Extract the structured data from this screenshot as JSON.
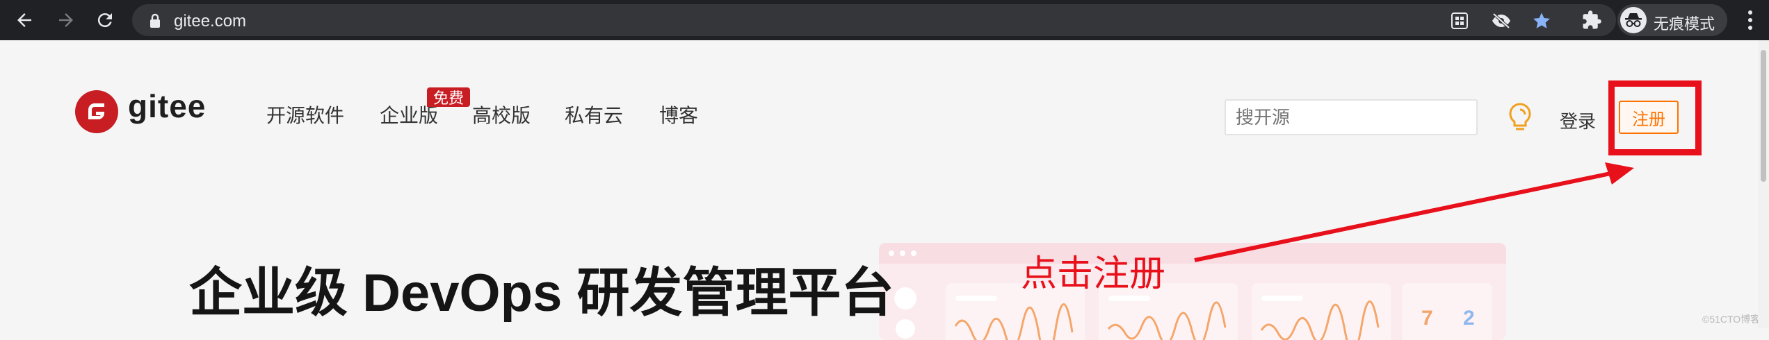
{
  "browser": {
    "url": "gitee.com",
    "incognito_label": "无痕模式"
  },
  "site": {
    "logo_text": "gitee",
    "nav": [
      {
        "label": "开源软件"
      },
      {
        "label": "企业版",
        "badge": "免费"
      },
      {
        "label": "高校版"
      },
      {
        "label": "私有云"
      },
      {
        "label": "博客"
      }
    ],
    "search_placeholder": "搜开源",
    "login_label": "登录",
    "register_label": "注册"
  },
  "hero": {
    "title": "企业级 DevOps 研发管理平台",
    "illustration_numbers": [
      "7",
      "2"
    ]
  },
  "annotation": {
    "text": "点击注册",
    "color": "#e8101b"
  },
  "watermark": "©51CTO博客",
  "colors": {
    "brand_red": "#c71d23",
    "register_orange": "#fe7300",
    "chrome_dark": "#202124"
  }
}
